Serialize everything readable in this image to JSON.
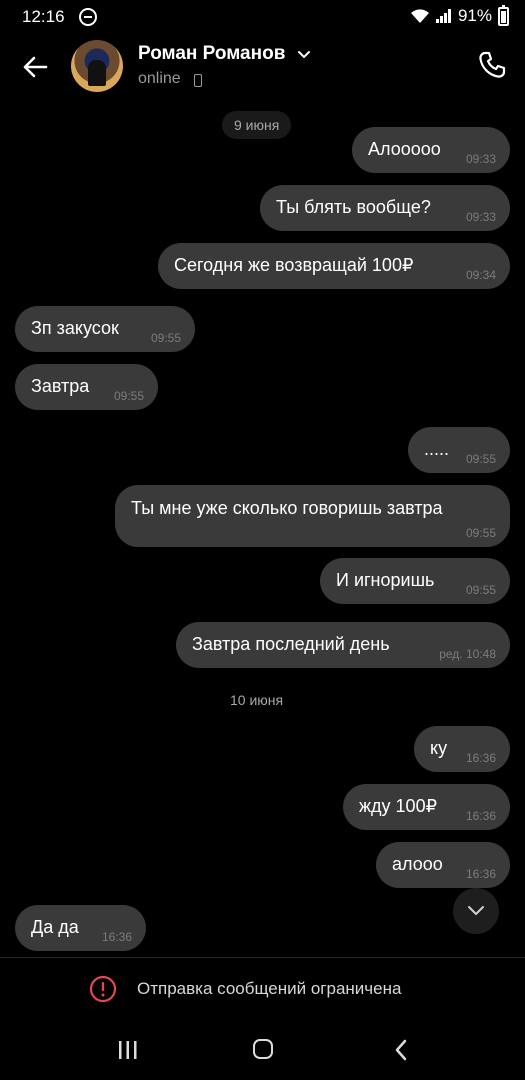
{
  "status_bar": {
    "time": "12:16",
    "battery": "91%"
  },
  "header": {
    "contact_name": "Роман Романов",
    "status": "online"
  },
  "dates": {
    "day1": "9 июня",
    "day2": "10 июня"
  },
  "messages": [
    {
      "text": "Алооооо",
      "time": "09:33",
      "side": "out"
    },
    {
      "text": "Ты блять вообще?",
      "time": "09:33",
      "side": "out"
    },
    {
      "text": "Сегодня же возвращай 100₽",
      "time": "09:34",
      "side": "out"
    },
    {
      "text": "Зп закусок",
      "time": "09:55",
      "side": "in"
    },
    {
      "text": "Завтра",
      "time": "09:55",
      "side": "in"
    },
    {
      "text": ".....",
      "time": "09:55",
      "side": "out"
    },
    {
      "text": "Ты мне уже сколько говоришь завтра",
      "time": "09:55",
      "side": "out"
    },
    {
      "text": "И игноришь",
      "time": "09:55",
      "side": "out"
    },
    {
      "text": "Завтра последний день",
      "time": "ред. 10:48",
      "side": "out"
    },
    {
      "text": "ку",
      "time": "16:36",
      "side": "out"
    },
    {
      "text": "жду 100₽",
      "time": "16:36",
      "side": "out"
    },
    {
      "text": "алооо",
      "time": "16:36",
      "side": "out"
    },
    {
      "text": "Да да",
      "time": "16:36",
      "side": "in"
    }
  ],
  "footer": {
    "restriction_text": "Отправка сообщений ограничена"
  },
  "icons": {
    "back": "arrow-left-icon",
    "call": "phone-icon",
    "scroll": "chevron-down-icon",
    "restrict": "alert-circle-icon"
  },
  "colors": {
    "background": "#000000",
    "bubble": "#3a3a3a",
    "alert": "#e5484d"
  }
}
